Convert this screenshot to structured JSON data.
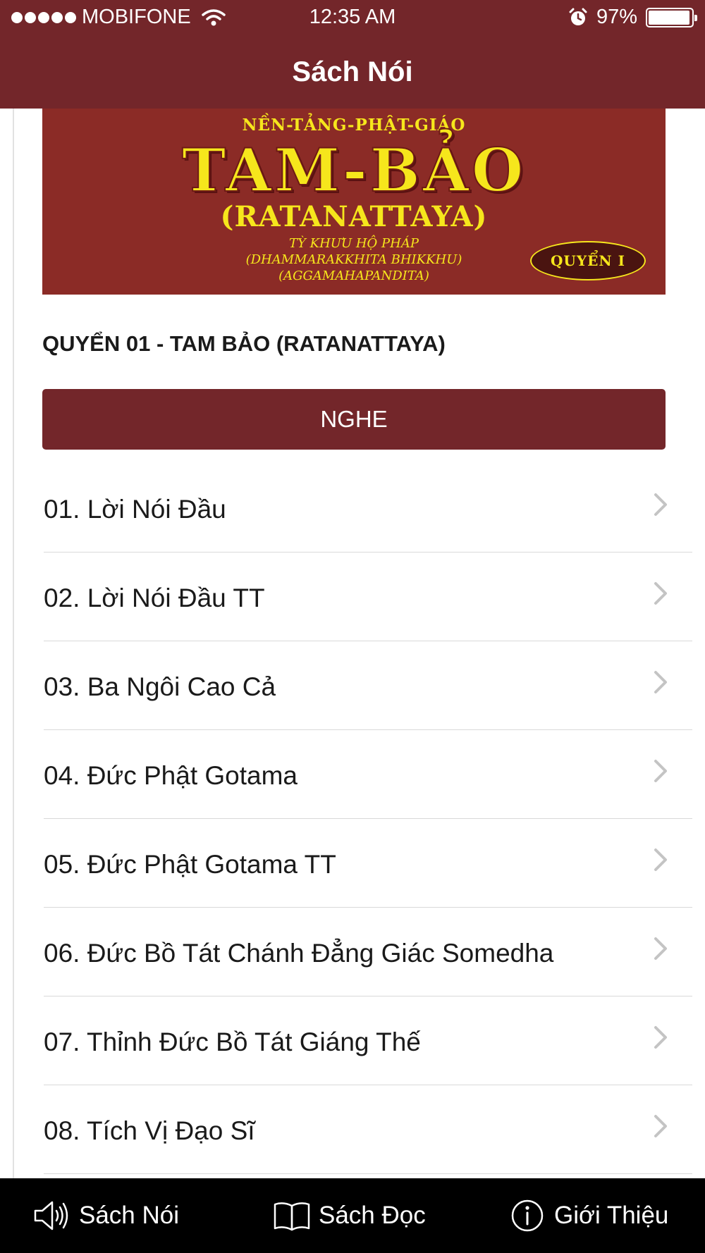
{
  "status": {
    "carrier": "MOBIFONE",
    "time": "12:35 AM",
    "battery": "97%",
    "battery_level": 0.97
  },
  "nav": {
    "title": "Sách Nói"
  },
  "banner": {
    "top_line": "NỀN-TẢNG-PHẬT-GIÁO",
    "title": "TAM-BẢO",
    "subtitle": "(RATANATTAYA)",
    "author_lines": [
      "TỲ KHƯU HỘ PHÁP",
      "(DHAMMARAKKHITA BHIKKHU)",
      "(AGGAMAHAPANDITA)"
    ],
    "badge": "QUYỂN I"
  },
  "book": {
    "heading": "QUYỂN 01 - TAM BẢO (RATANATTAYA)"
  },
  "listen_button": {
    "label": "NGHE"
  },
  "tracks": [
    {
      "label": "01. Lời Nói Đầu"
    },
    {
      "label": "02. Lời Nói Đầu TT"
    },
    {
      "label": "03. Ba Ngôi Cao Cả"
    },
    {
      "label": "04. Đức Phật Gotama"
    },
    {
      "label": "05. Đức Phật Gotama TT"
    },
    {
      "label": "06. Đức Bồ Tát Chánh Đẳng Giác Somedha"
    },
    {
      "label": "07. Thỉnh Đức Bồ Tát Giáng Thế"
    },
    {
      "label": "08. Tích Vị Đạo Sĩ"
    }
  ],
  "tabs": [
    {
      "label": "Sách Nói",
      "icon": "speaker-icon"
    },
    {
      "label": "Sách Đọc",
      "icon": "book-icon"
    },
    {
      "label": "Giới Thiệu",
      "icon": "info-icon"
    }
  ],
  "colors": {
    "primary": "#73262a",
    "banner_bg": "#8b2b26",
    "banner_text": "#f6e61c",
    "tab_bar_bg": "#000000"
  }
}
